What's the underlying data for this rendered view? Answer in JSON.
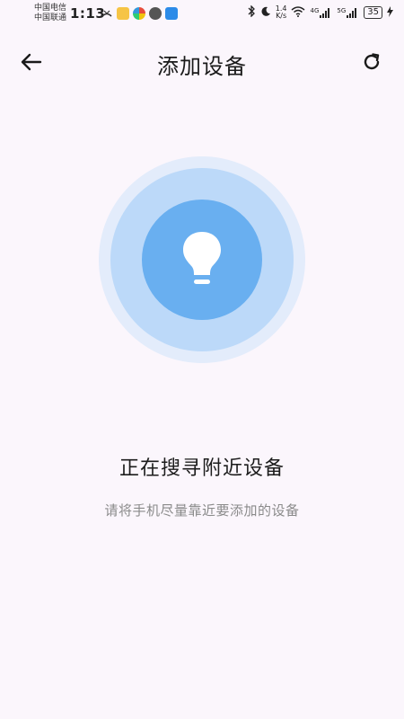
{
  "status_bar": {
    "carrier_1": "中国电信",
    "carrier_2": "中国联通",
    "time": "1:13",
    "net_speed_value": "1.4",
    "net_speed_unit": "K/s",
    "signal_1": "4G",
    "signal_2": "5G",
    "battery": "35"
  },
  "header": {
    "title": "添加设备"
  },
  "search": {
    "title": "正在搜寻附近设备",
    "hint": "请将手机尽量靠近要添加的设备"
  }
}
